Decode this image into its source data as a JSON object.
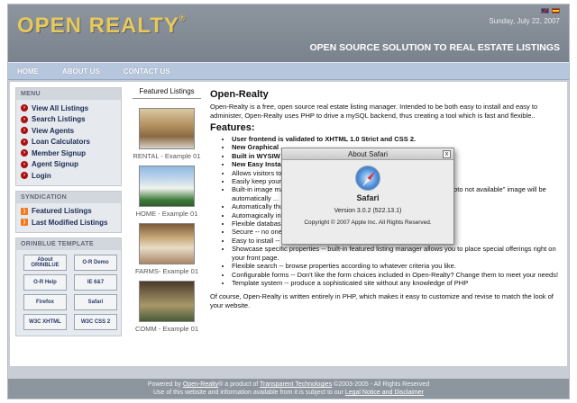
{
  "header": {
    "logo": "OPEN REALTY",
    "logo_mark": "®",
    "date": "Sunday, July 22, 2007",
    "tagline": "OPEN SOURCE SOLUTION TO REAL ESTATE LISTINGS"
  },
  "nav": {
    "items": [
      "HOME",
      "ABOUT US",
      "CONTACT US"
    ]
  },
  "sidebar": {
    "menu": {
      "title": "MENU",
      "items": [
        "View All Listings",
        "Search Listings",
        "View Agents",
        "Loan Calculators",
        "Member Signup",
        "Agent Signup",
        "Login"
      ]
    },
    "syndication": {
      "title": "SYNDICATION",
      "items": [
        "Featured Listings",
        "Last Modified Listings"
      ]
    },
    "template": {
      "title": "ORINBLUE TEMPLATE",
      "badges": [
        "About ORINBLUE",
        "O-R Demo",
        "O-R Help",
        "IE 6&7",
        "Firefox",
        "Safari",
        "W3C XHTML",
        "W3C CSS 2"
      ]
    }
  },
  "featured": {
    "title": "Featured Listings",
    "listings": [
      "RENTAL - Example 01",
      "HOME - Example 01",
      "FARMS- Example 01",
      "COMM - Example 01"
    ]
  },
  "main": {
    "title": "Open-Realty",
    "intro": "Open-Realty is a free, open source real estate listing manager. Intended to be both easy to install and easy to administer, Open-Realty uses PHP to drive a mySQL backend, thus creating a tool which is fast and flexible..",
    "features_title": "Features:",
    "features": [
      "User frontend is validated to XHTML 1.0 Strict and CSS 2.",
      "New Graphical ...",
      "Built in WYSIW ... es.",
      "New Easy Insta ...",
      "Allows visitors to ... 7 days a week, 365.25 days a year.",
      "Easily keep your ... to add, delete, or modify listings.",
      "Built-in image ma ... when creating new listings or modifying an exis ... \"photo not available\" image will be automatically ...",
      "Automatically thu ... atically created through the GD library.",
      "Automagically int ... ways know exactly where to find your property ...",
      "Flexible databas ... QL, etc... through the ADODB abstraction layer.",
      "Secure -- no one but you can change your listings.",
      "Easy to install -- just edit a single configuration file.",
      "Showcase specific properties -- built-in featured listing manager allows you to place special offerings right on your front page.",
      "Flexible search -- browse properties according to whatever criteria you like.",
      "Configurable forms -- Don't like the form choices included in Open-Realty? Change them to meet your needs!",
      "Template system -- produce a sophisticated site without any knowledge of PHP"
    ],
    "outro": "Of course, Open-Realty is written entirely in PHP, which makes it easy to customize and revise to match the look of your website."
  },
  "dialog": {
    "title": "About Safari",
    "close": "x",
    "app_name": "Safari",
    "version": "Version 3.0.2 (522.13.1)",
    "copyright": "Copyright © 2007 Apple Inc. All Rights Reserved."
  },
  "footer": {
    "powered_by": "Powered by",
    "or_link": "Open-Realty",
    "product_of": "® a product of",
    "tt_link": "Transparent Technologies",
    "rights": "©2003-2005 - All Rights Reserved",
    "use_text": "Use of this website and information available from it is subject to our",
    "legal_link": "Legal Notice and Disclaimer"
  }
}
